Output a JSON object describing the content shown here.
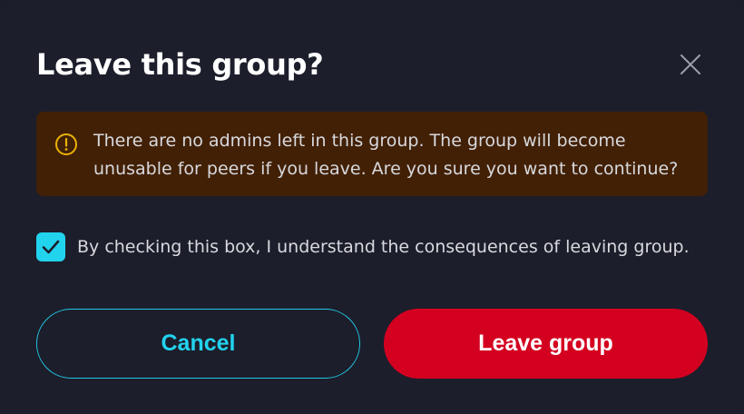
{
  "dialog": {
    "title": "Leave this group?",
    "close_icon": "close-icon",
    "warning": {
      "icon": "warning-circle-icon",
      "text": "There are no admins left in this group. The group will become unusable for peers if you leave. Are you sure you want to continue?"
    },
    "confirm": {
      "checked": true,
      "label": "By checking this box, I understand the consequences of leaving group."
    },
    "buttons": {
      "cancel_label": "Cancel",
      "leave_label": "Leave group"
    }
  },
  "colors": {
    "background": "#1c1e2b",
    "warning_bg": "#422005",
    "warning_icon": "#eab308",
    "accent": "#22d3ee",
    "danger": "#d40020"
  }
}
